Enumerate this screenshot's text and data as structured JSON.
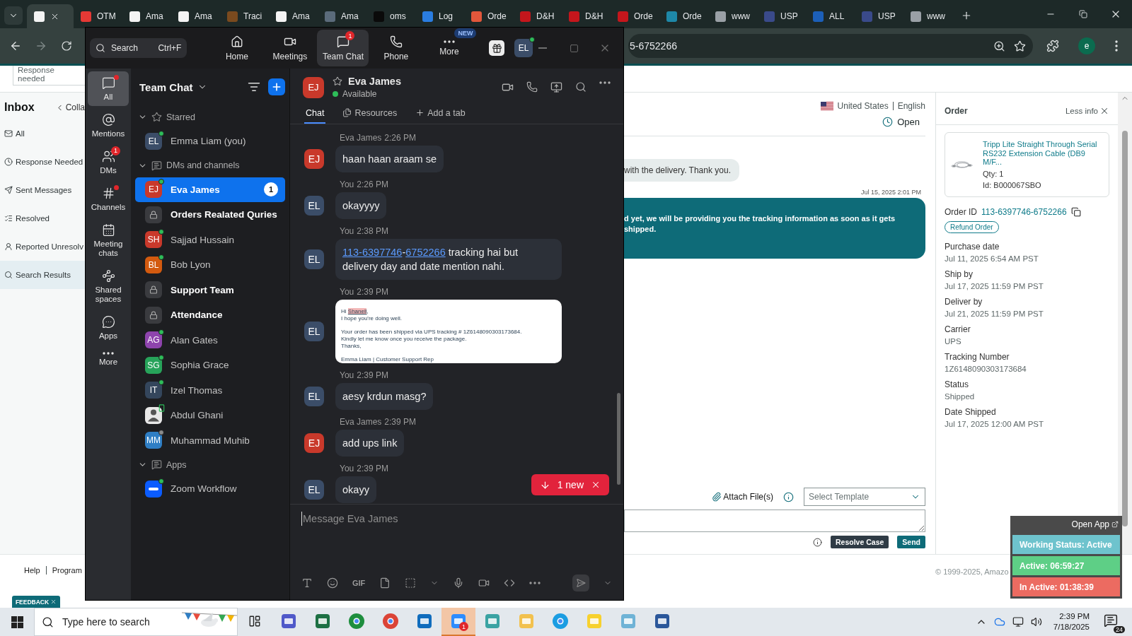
{
  "browser": {
    "tabs": [
      {
        "selected": true,
        "color": "#f4f4f4"
      },
      {
        "label": "OTM",
        "selected": false,
        "color": "#e53935"
      },
      {
        "label": "Ama",
        "selected": false,
        "color": "#f4f4f4"
      },
      {
        "label": "Ama",
        "selected": false,
        "color": "#f4f4f4"
      },
      {
        "label": "Traci",
        "selected": false,
        "color": "#7a4a1e"
      },
      {
        "label": "Ama",
        "selected": false,
        "color": "#f4f4f4"
      },
      {
        "label": "Ama",
        "selected": false,
        "color": "#5b6b7b"
      },
      {
        "label": "oms",
        "selected": false,
        "color": "#0a0a0a"
      },
      {
        "label": "Log",
        "selected": false,
        "color": "#2a7de1"
      },
      {
        "label": "Orde",
        "selected": false,
        "color": "#e2573b"
      },
      {
        "label": "D&H",
        "selected": false,
        "color": "#c4161c"
      },
      {
        "label": "D&H",
        "selected": false,
        "color": "#c4161c"
      },
      {
        "label": "Orde",
        "selected": false,
        "color": "#c4161c"
      },
      {
        "label": "Orde",
        "selected": false,
        "color": "#1e88a8"
      },
      {
        "label": "www",
        "selected": false,
        "color": "#9aa0a6"
      },
      {
        "label": "USP",
        "selected": false,
        "color": "#3a4a8a"
      },
      {
        "label": "ALL",
        "selected": false,
        "color": "#1c5fb8"
      },
      {
        "label": "USP",
        "selected": false,
        "color": "#3a4a8a"
      },
      {
        "label": "www",
        "selected": false,
        "color": "#9aa0a6"
      }
    ],
    "address": "5-6752266",
    "profile_initial": "e"
  },
  "amazon": {
    "top_card_text": "Response needed",
    "inbox_title": "Inbox",
    "collapse_label": "Colla",
    "nav": [
      {
        "label": "All",
        "kind": "mail",
        "selected": false
      },
      {
        "label": "Response Needed",
        "kind": "clock",
        "selected": false
      },
      {
        "label": "Sent Messages",
        "kind": "send",
        "selected": false
      },
      {
        "label": "Resolved",
        "kind": "resolved",
        "selected": false
      },
      {
        "label": "Reported Unresolv",
        "kind": "reported",
        "selected": false
      },
      {
        "label": "Search Results",
        "kind": "search",
        "selected": true
      }
    ],
    "locale": {
      "country": "United States",
      "language": "English"
    },
    "case_status": "Open",
    "messages": [
      {
        "kind": "incoming",
        "text": "with the delivery. Thank you."
      },
      {
        "kind": "outgoing",
        "time": "Jul 15, 2025 2:01 PM",
        "text": "d yet, we will be providing you the tracking information as soon as it gets shipped."
      }
    ],
    "attach_label": "Attach File(s)",
    "template_placeholder": "Select Template",
    "actions": [
      {
        "label": "Resolve Case",
        "kind": "secondary"
      },
      {
        "label": "Send",
        "kind": "primary"
      }
    ],
    "footer_links": [
      "Help",
      "Program"
    ],
    "copyright": "© 1999-2025, Amazo",
    "feedback": "FEEDBACK",
    "order": {
      "title": "Order",
      "less_info": "Less info",
      "product": {
        "title": "Tripp Lite Straight Through Serial RS232 Extension Cable (DB9 M/F...",
        "qty": "Qty: 1",
        "id": "Id: B000067SBO"
      },
      "order_id_label": "Order ID",
      "order_id": "113-6397746-6752266",
      "refund": "Refund Order",
      "fields": [
        {
          "label": "Purchase date",
          "value": "Jul 11, 2025 6:54 AM PST"
        },
        {
          "label": "Ship by",
          "value": "Jul 17, 2025 11:59 PM PST"
        },
        {
          "label": "Deliver by",
          "value": "Jul 21, 2025 11:59 PM PST"
        },
        {
          "label": "Carrier",
          "value": "UPS"
        },
        {
          "label": "Tracking Number",
          "value": "1Z6148090303173684"
        },
        {
          "label": "Status",
          "value": "Shipped"
        },
        {
          "label": "Date Shipped",
          "value": "Jul 17, 2025 12:00 AM PST"
        }
      ]
    }
  },
  "widget": {
    "open_app": "Open App",
    "rows": [
      {
        "kind": "status",
        "text": "Working Status: Active"
      },
      {
        "kind": "active",
        "text": "Active: 06:59:27"
      },
      {
        "kind": "inactive",
        "text": "In Active: 01:38:39"
      }
    ]
  },
  "zoom": {
    "search": {
      "placeholder": "Search",
      "shortcut": "Ctrl+F"
    },
    "nav": [
      {
        "label": "Home",
        "kind": "home",
        "selected": false
      },
      {
        "label": "Meetings",
        "kind": "video",
        "selected": false
      },
      {
        "label": "Team Chat",
        "kind": "chat",
        "selected": true,
        "badge": "1"
      },
      {
        "label": "Phone",
        "kind": "phone",
        "selected": false
      },
      {
        "label": "More",
        "kind": "more",
        "selected": false,
        "tag": "NEW"
      }
    ],
    "profile": {
      "initials": "EL",
      "online": true
    },
    "rail": [
      {
        "label": "All",
        "kind": "chat",
        "selected": true,
        "unread_dot": true
      },
      {
        "label": "Mentions",
        "kind": "at",
        "selected": false,
        "unread_dot": false
      },
      {
        "label": "DMs",
        "kind": "people",
        "selected": false,
        "unread_dot": false,
        "badge": "1"
      },
      {
        "label": "Channels",
        "kind": "hash",
        "selected": false,
        "unread_dot": true
      },
      {
        "label": "Meeting chats",
        "kind": "calendar",
        "selected": false,
        "unread_dot": false
      },
      {
        "label": "Shared spaces",
        "kind": "share",
        "selected": false,
        "unread_dot": false
      },
      {
        "label": "Apps",
        "kind": "apps",
        "selected": false,
        "unread_dot": false
      },
      {
        "label": "More",
        "kind": "more",
        "selected": false,
        "unread_dot": false
      }
    ],
    "list": {
      "title": "Team Chat",
      "sections": [
        {
          "label": "Starred",
          "kind": "star",
          "expanded": true,
          "children": [
            {
              "name": "Emma Liam (you)",
              "kind": "avatar",
              "initials": "EL",
              "color": "#3b4d68",
              "online": true,
              "unread": false,
              "selected": false
            }
          ]
        },
        {
          "label": "DMs and channels",
          "kind": "chat",
          "expanded": true,
          "children": [
            {
              "name": "Eva James",
              "kind": "avatar",
              "initials": "EJ",
              "color": "#c9392b",
              "online": true,
              "unread": true,
              "selected": true,
              "badge": "1"
            },
            {
              "name": "Orders Realated Quries",
              "kind": "channel",
              "unread": true,
              "selected": false
            },
            {
              "name": "Sajjad Hussain",
              "kind": "avatar",
              "initials": "SH",
              "color": "#c9392b",
              "online": true,
              "unread": false,
              "selected": false
            },
            {
              "name": "Bob Lyon",
              "kind": "avatar",
              "initials": "BL",
              "color": "#d35a0f",
              "online": true,
              "unread": false,
              "selected": false
            },
            {
              "name": "Support Team",
              "kind": "channel",
              "unread": true,
              "selected": false
            },
            {
              "name": "Attendance",
              "kind": "channel",
              "unread": true,
              "selected": false
            },
            {
              "name": "Alan Gates",
              "kind": "avatar",
              "initials": "AG",
              "color": "#8e44ad",
              "online": true,
              "unread": false,
              "selected": false
            },
            {
              "name": "Sophia Grace",
              "kind": "avatar",
              "initials": "SG",
              "color": "#27a35a",
              "online": true,
              "unread": false,
              "selected": false
            },
            {
              "name": "Izel Thomas",
              "kind": "avatar",
              "initials": "IT",
              "color": "#34465c",
              "online": true,
              "unread": false,
              "selected": false
            },
            {
              "name": "Abdul Ghani",
              "mobile": true,
              "unread": false,
              "selected": false
            },
            {
              "name": "Muhammad Muhib",
              "kind": "avatar",
              "initials": "MM",
              "color": "#2f7ec4",
              "online": false,
              "unread": false,
              "selected": false
            }
          ]
        },
        {
          "label": "Apps",
          "kind": "chat",
          "expanded": true,
          "children": [
            {
              "name": "Zoom Workflow",
              "kind": "app",
              "online": true,
              "unread": false,
              "selected": false
            }
          ]
        }
      ]
    },
    "chat": {
      "contact": {
        "initials": "EJ",
        "color": "#c9392b",
        "name": "Eva James",
        "status": "Available"
      },
      "tabs": [
        {
          "label": "Chat",
          "kind": "chat",
          "selected": true
        },
        {
          "label": "Resources",
          "kind": "resources",
          "selected": false
        },
        {
          "label": "Add a tab",
          "kind": "add",
          "selected": false
        }
      ],
      "messages": [
        {
          "initials": "EJ",
          "color": "#c9392b",
          "sender": "Eva James",
          "time": "2:26 PM",
          "kind": "text",
          "text": "haan haan araam se"
        },
        {
          "initials": "EL",
          "color": "#3b4d68",
          "sender": "You",
          "time": "2:26 PM",
          "kind": "text",
          "text": "okayyyy"
        },
        {
          "initials": "EL",
          "color": "#3b4d68",
          "sender": "You",
          "time": "2:38 PM",
          "kind": "links",
          "parts": [
            {
              "text": "113-6397746",
              "kind": "link"
            },
            {
              "text": "-",
              "kind": "plain"
            },
            {
              "text": "6752266",
              "kind": "link"
            },
            {
              "text": " tracking hai but delivery day and date mention nahi.",
              "kind": "plain"
            }
          ]
        },
        {
          "initials": "EL",
          "color": "#3b4d68",
          "sender": "You",
          "time": "2:39 PM",
          "email": {
            "greeting": "Hi",
            "name": "Shanell",
            "after_name": ",",
            "lines": [
              "I hope you're doing well.",
              "Your order has been shipped via UPS tracking # 1Z6148090303173684.",
              "Kindly let me know once you receive the package.",
              "Thanks,",
              "Emma Liam | Customer Support Rep"
            ]
          }
        },
        {
          "initials": "EL",
          "color": "#3b4d68",
          "sender": "You",
          "time": "2:39 PM",
          "kind": "text",
          "text": "aesy krdun masg?"
        },
        {
          "initials": "EJ",
          "color": "#c9392b",
          "sender": "Eva James",
          "time": "2:39 PM",
          "kind": "text",
          "text": "add ups link"
        },
        {
          "initials": "EL",
          "color": "#3b4d68",
          "sender": "You",
          "time": "2:39 PM",
          "kind": "text",
          "text": "okayy"
        }
      ],
      "new_pill": "1 new",
      "composer": {
        "placeholder": "Message Eva James",
        "gif": "GIF"
      }
    }
  },
  "taskbar": {
    "search_placeholder": "Type here to search",
    "apps": [
      {
        "kind": "teams",
        "selected": false
      },
      {
        "kind": "excel",
        "selected": false
      },
      {
        "kind": "chrome",
        "selected": false
      },
      {
        "kind": "chrome-profile",
        "selected": false
      },
      {
        "kind": "outlook",
        "selected": false
      },
      {
        "kind": "zoom",
        "selected": true,
        "badge": "1"
      },
      {
        "kind": "cube",
        "selected": false
      },
      {
        "kind": "folder",
        "selected": false
      },
      {
        "kind": "edge",
        "selected": false
      },
      {
        "kind": "notes",
        "selected": false
      },
      {
        "kind": "notepad",
        "selected": false
      },
      {
        "kind": "word",
        "selected": false
      }
    ],
    "time": "2:39 PM",
    "date": "7/18/2025",
    "notifications": "24"
  }
}
